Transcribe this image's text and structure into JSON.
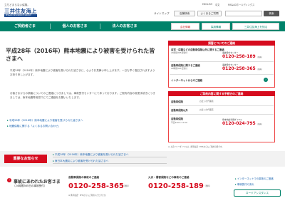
{
  "header": {
    "tagline": "立ちどまらない保険。",
    "logo_name": "三井住友海上",
    "logo_sub": "MS&AD INSURANCE GROUP",
    "lang_en": "ENGLISH",
    "lang_cn": "中文",
    "holdings": "MS&ADホールディングス",
    "sitemap": "サイトマップ",
    "store_search": "店舗検索",
    "faq": "よくあるご質問",
    "search_button": "検索"
  },
  "gnav": {
    "items": [
      "ご契約者さま",
      "個人のお客さま",
      "法人のお客さま"
    ],
    "side": [
      "会社情報",
      "採用情報",
      "三井住友海上を知る"
    ]
  },
  "main": {
    "title": "平成28年（2016年）熊本地震により被害を受けられた皆さまへ",
    "para1": "平成28年（2016年）熊本地震により被害を受けられた皆さまに、心よりお見舞い申し上げます。一日も早く復旧されますようお祈り申し上げます。",
    "para2": "お客さまからの損害についてのご連絡につきましては、事故受付センターにて承っております。ご契約内容の変更手続きにつきましては、熊本地震専用窓口にてご連絡をお願いいたします。",
    "link1": "平成28年（2016年）熊本地震により被害を受けられた皆さまへ",
    "link2": "地震保険に関する「よくあるお問い合わせ」"
  },
  "panel": {
    "head": "損害についてのご連絡",
    "rows": [
      {
        "label": "自宅・店舗などの自動車保険以外に関するご連絡",
        "sub": "24時間365日受付",
        "tel_label": "事故受付センター",
        "tel": "0120-258-189",
        "free": "（無料）"
      },
      {
        "label": "自動車保険に関するご連絡",
        "sub": "24時間365日受付",
        "tel_label": "事故受付センター",
        "tel": "0120-258-365",
        "free": "（無料）"
      },
      {
        "label": "インターネットからのご連絡",
        "sub": "",
        "tel_label": "",
        "tel": "",
        "free": ""
      }
    ],
    "head2": "ご契約内容に関する手続きのご連絡",
    "rows2": [
      {
        "label": "自動車保険",
        "sub": "お近くの代理店"
      },
      {
        "label": "自動車保険以外",
        "sub": "お近くの代理店"
      },
      {
        "label": "自動車保険",
        "sub": "平日9:00〜17:00"
      }
    ],
    "tel2_label": "熊本地震専用ダイヤル",
    "tel2": "0120-024-795",
    "free2": "（無料）",
    "note": "※ 上記フリーダイヤルは、携帯電話・PHSからもご利用可能です。"
  },
  "important": {
    "tag": "重要なお知らせ",
    "items": [
      "平成28年（2016年）熊本地震により被害を受けられた皆さまへ",
      "東日本大震災により被害を受けられた皆さまへ"
    ]
  },
  "accident": {
    "title": "事故にあわれたお客さま",
    "sub": "（24時間365日の事故受付）",
    "car_label": "自動車保険の事故のご連絡",
    "car_tel": "0120-258-365",
    "fire_label": "火災・傷害保険などの事故のご連絡",
    "fire_tel": "0120-258-189",
    "free": "（無料）",
    "note": "※ 携帯電話・PHSからもご利用いただけます。",
    "links": [
      "インターネットでの事故のご連絡",
      "事故受付の流れ"
    ],
    "button": "ロードアシスタンス"
  }
}
